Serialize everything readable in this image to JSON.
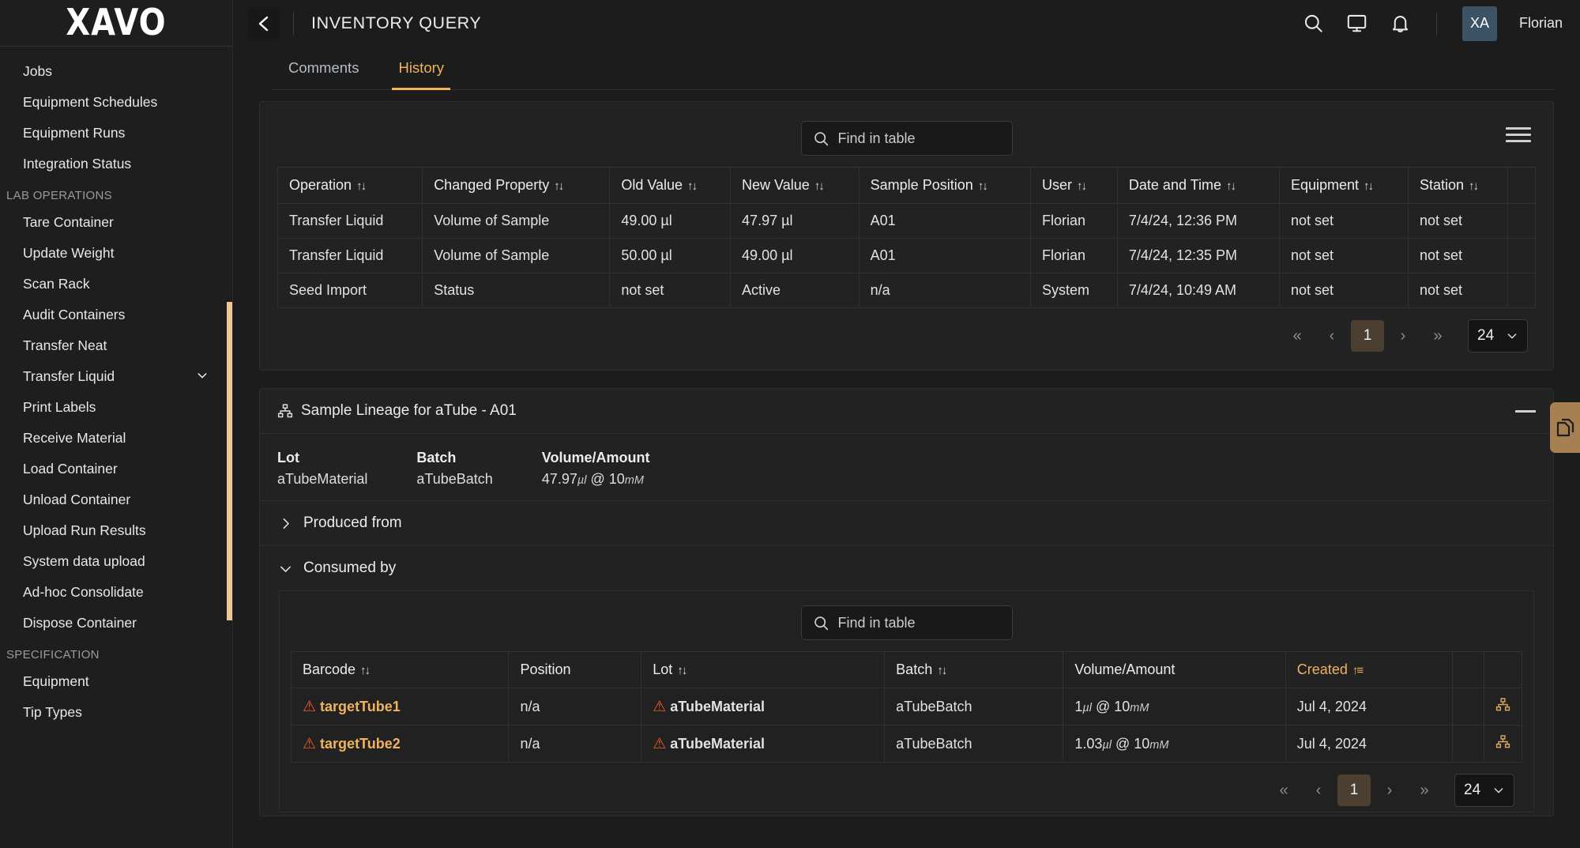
{
  "brand": {
    "logo_text": "XAVO"
  },
  "sidebar": {
    "items": [
      {
        "label": "Jobs",
        "type": "item"
      },
      {
        "label": "Equipment Schedules",
        "type": "item"
      },
      {
        "label": "Equipment Runs",
        "type": "item"
      },
      {
        "label": "Integration Status",
        "type": "item"
      },
      {
        "label": "LAB OPERATIONS",
        "type": "section"
      },
      {
        "label": "Tare Container",
        "type": "item"
      },
      {
        "label": "Update Weight",
        "type": "item"
      },
      {
        "label": "Scan Rack",
        "type": "item"
      },
      {
        "label": "Audit Containers",
        "type": "item"
      },
      {
        "label": "Transfer Neat",
        "type": "item"
      },
      {
        "label": "Transfer Liquid",
        "type": "item",
        "expandable": true,
        "chevron": "chevron-down-icon"
      },
      {
        "label": "Print Labels",
        "type": "item"
      },
      {
        "label": "Receive Material",
        "type": "item"
      },
      {
        "label": "Load Container",
        "type": "item"
      },
      {
        "label": "Unload Container",
        "type": "item"
      },
      {
        "label": "Upload Run Results",
        "type": "item"
      },
      {
        "label": "System data upload",
        "type": "item"
      },
      {
        "label": "Ad-hoc Consolidate",
        "type": "item"
      },
      {
        "label": "Dispose Container",
        "type": "item"
      },
      {
        "label": "SPECIFICATION",
        "type": "section"
      },
      {
        "label": "Equipment",
        "type": "item"
      },
      {
        "label": "Tip Types",
        "type": "item"
      }
    ],
    "scrollbar_color": "#f0c794"
  },
  "header": {
    "back_icon": "chevron-left-icon",
    "title": "INVENTORY QUERY",
    "icons": [
      "search-icon",
      "monitor-icon",
      "bell-icon"
    ],
    "avatar_initials": "XA",
    "avatar_color": "#3c5366",
    "user_name": "Florian"
  },
  "tabs": [
    {
      "label": "Comments",
      "active": false
    },
    {
      "label": "History",
      "active": true
    }
  ],
  "accent_color": "#f2b35a",
  "history_panel": {
    "search": {
      "placeholder": "Find in table",
      "value": "",
      "icon": "search-icon"
    },
    "menu_icon": "hamburger-menu-icon",
    "columns": [
      {
        "label": "Operation",
        "sortable": true
      },
      {
        "label": "Changed Property",
        "sortable": true
      },
      {
        "label": "Old Value",
        "sortable": true
      },
      {
        "label": "New Value",
        "sortable": true
      },
      {
        "label": "Sample Position",
        "sortable": true
      },
      {
        "label": "User",
        "sortable": true
      },
      {
        "label": "Date and Time",
        "sortable": true
      },
      {
        "label": "Equipment",
        "sortable": true
      },
      {
        "label": "Station",
        "sortable": true
      }
    ],
    "rows": [
      {
        "operation": "Transfer Liquid",
        "changed_property": "Volume of Sample",
        "old_value": "49.00 µl",
        "new_value": "47.97 µl",
        "sample_position": "A01",
        "user": "Florian",
        "date_time": "7/4/24, 12:36 PM",
        "equipment": "not set",
        "station": "not set",
        "equipment_muted": true,
        "station_muted": true,
        "old_muted": false,
        "pos_muted": false
      },
      {
        "operation": "Transfer Liquid",
        "changed_property": "Volume of Sample",
        "old_value": "50.00 µl",
        "new_value": "49.00 µl",
        "sample_position": "A01",
        "user": "Florian",
        "date_time": "7/4/24, 12:35 PM",
        "equipment": "not set",
        "station": "not set",
        "equipment_muted": true,
        "station_muted": true,
        "old_muted": false,
        "pos_muted": false
      },
      {
        "operation": "Seed Import",
        "changed_property": "Status",
        "old_value": "not set",
        "new_value": "Active",
        "sample_position": "n/a",
        "user": "System",
        "date_time": "7/4/24, 10:49 AM",
        "equipment": "not set",
        "station": "not set",
        "equipment_muted": true,
        "station_muted": true,
        "old_muted": true,
        "pos_muted": true
      }
    ],
    "pagination": {
      "first": "«",
      "prev": "‹",
      "current_page": "1",
      "next": "›",
      "last": "»",
      "page_size": "24",
      "page_size_chevron": "chevron-down-icon"
    }
  },
  "lineage_panel": {
    "icon": "hierarchy-icon",
    "title": "Sample Lineage for aTube - A01",
    "minimize_icon": "minimize-icon",
    "meta": [
      {
        "label": "Lot",
        "value": "aTubeMaterial"
      },
      {
        "label": "Batch",
        "value": "aTubeBatch"
      },
      {
        "label": "Volume/Amount",
        "value": "47.97",
        "unit1": "µl",
        "at": "@",
        "value2": "10",
        "unit2": "mM"
      }
    ],
    "sections": [
      {
        "label": "Produced from",
        "expanded": false,
        "chevron": "chevron-right-icon"
      },
      {
        "label": "Consumed by",
        "expanded": true,
        "chevron": "chevron-down-icon"
      }
    ],
    "consumed_by": {
      "search": {
        "placeholder": "Find in table",
        "value": "",
        "icon": "search-icon"
      },
      "columns": [
        {
          "label": "Barcode",
          "sortable": true,
          "active": false
        },
        {
          "label": "Position",
          "sortable": false,
          "active": false
        },
        {
          "label": "Lot",
          "sortable": true,
          "active": false
        },
        {
          "label": "Batch",
          "sortable": true,
          "active": false
        },
        {
          "label": "Volume/Amount",
          "sortable": false,
          "active": false
        },
        {
          "label": "Created",
          "sortable": true,
          "active": true,
          "sort_dir": "asc"
        }
      ],
      "rows": [
        {
          "barcode": "targetTube1",
          "barcode_warning": true,
          "position": "n/a",
          "lot": "aTubeMaterial",
          "lot_warning": true,
          "batch": "aTubeBatch",
          "volume": "1",
          "volume_unit": "µl",
          "at": "@",
          "conc": "10",
          "conc_unit": "mM",
          "created": "Jul 4, 2024",
          "action_icon": "hierarchy-icon"
        },
        {
          "barcode": "targetTube2",
          "barcode_warning": true,
          "position": "n/a",
          "lot": "aTubeMaterial",
          "lot_warning": true,
          "batch": "aTubeBatch",
          "volume": "1.03",
          "volume_unit": "µl",
          "at": "@",
          "conc": "10",
          "conc_unit": "mM",
          "created": "Jul 4, 2024",
          "action_icon": "hierarchy-icon"
        }
      ],
      "pagination": {
        "first": "«",
        "prev": "‹",
        "current_page": "1",
        "next": "›",
        "last": "»",
        "page_size": "24",
        "page_size_chevron": "chevron-down-icon"
      }
    }
  },
  "floating_action": {
    "icon": "copy-documents-icon",
    "color": "#a78052"
  }
}
